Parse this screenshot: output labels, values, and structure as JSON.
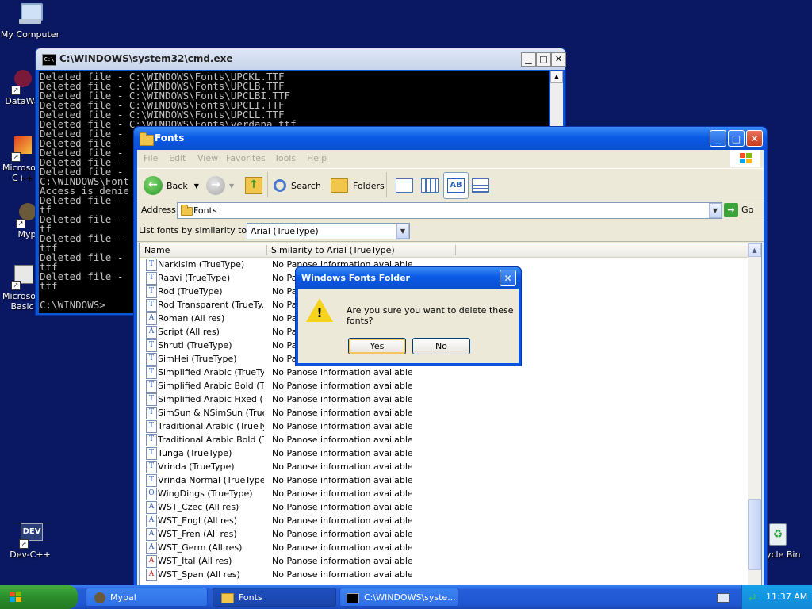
{
  "desktop": {
    "icons": [
      {
        "label": "My Computer"
      },
      {
        "label": "DataWa"
      },
      {
        "label": "Microsoft C++"
      },
      {
        "label": "Myp"
      },
      {
        "label": "Microsoft Basic"
      },
      {
        "label": "Dev-C++"
      },
      {
        "label": "ycle Bin"
      }
    ]
  },
  "cmd": {
    "title": "C:\\WINDOWS\\system32\\cmd.exe",
    "lines": [
      "Deleted file - C:\\WINDOWS\\Fonts\\UPCKL.TTF",
      "Deleted file - C:\\WINDOWS\\Fonts\\UPCLB.TTF",
      "Deleted file - C:\\WINDOWS\\Fonts\\UPCLBI.TTF",
      "Deleted file - C:\\WINDOWS\\Fonts\\UPCLI.TTF",
      "Deleted file - C:\\WINDOWS\\Fonts\\UPCLL.TTF",
      "Deleted file - C:\\WINDOWS\\Fonts\\verdana.ttf",
      "Deleted file -",
      "Deleted file -",
      "Deleted file -",
      "Deleted file -",
      "Deleted file -",
      "C:\\WINDOWS\\Font",
      "Access is denie",
      "Deleted file -",
      "tf",
      "Deleted file -",
      "tf",
      "Deleted file -",
      "ttf",
      "Deleted file -",
      "ttf",
      "Deleted file -",
      "ttf",
      "",
      "C:\\WINDOWS>"
    ]
  },
  "fonts_window": {
    "title": "Fonts",
    "menu": [
      "File",
      "Edit",
      "View",
      "Favorites",
      "Tools",
      "Help"
    ],
    "toolbar": {
      "back": "Back",
      "search": "Search",
      "folders": "Folders"
    },
    "address_label": "Address",
    "address_value": "Fonts",
    "go_label": "Go",
    "similarity_label": "List fonts by similarity to:",
    "similarity_value": "Arial (TrueType)",
    "columns": {
      "name": "Name",
      "similarity": "Similarity to Arial (TrueType)"
    },
    "rows": [
      {
        "name": "Narkisim (TrueType)",
        "sim": "No Panose information available",
        "icon": "T"
      },
      {
        "name": "Raavi (TrueType)",
        "sim": "No Par",
        "icon": "T"
      },
      {
        "name": "Rod (TrueType)",
        "sim": "No Par",
        "icon": "T"
      },
      {
        "name": "Rod Transparent (TrueTy...",
        "sim": "No Par",
        "icon": "T"
      },
      {
        "name": "Roman (All res)",
        "sim": "No Par",
        "icon": "A"
      },
      {
        "name": "Script (All res)",
        "sim": "No Par",
        "icon": "A"
      },
      {
        "name": "Shruti (TrueType)",
        "sim": "No Par",
        "icon": "T"
      },
      {
        "name": "SimHei (TrueType)",
        "sim": "No Par",
        "icon": "T"
      },
      {
        "name": "Simplified Arabic (TrueType)",
        "sim": "No Panose information available",
        "icon": "T"
      },
      {
        "name": "Simplified Arabic Bold (Tru...",
        "sim": "No Panose information available",
        "icon": "T"
      },
      {
        "name": "Simplified Arabic Fixed (Tr...",
        "sim": "No Panose information available",
        "icon": "T"
      },
      {
        "name": "SimSun & NSimSun (TrueT...",
        "sim": "No Panose information available",
        "icon": "T"
      },
      {
        "name": "Traditional Arabic (TrueTy...",
        "sim": "No Panose information available",
        "icon": "T"
      },
      {
        "name": "Traditional Arabic Bold (Tr...",
        "sim": "No Panose information available",
        "icon": "T"
      },
      {
        "name": "Tunga (TrueType)",
        "sim": "No Panose information available",
        "icon": "T"
      },
      {
        "name": "Vrinda (TrueType)",
        "sim": "No Panose information available",
        "icon": "T"
      },
      {
        "name": "Vrinda Normal (TrueType)",
        "sim": "No Panose information available",
        "icon": "T"
      },
      {
        "name": "WingDings (TrueType)",
        "sim": "No Panose information available",
        "icon": "O"
      },
      {
        "name": "WST_Czec (All res)",
        "sim": "No Panose information available",
        "icon": "A"
      },
      {
        "name": "WST_Engl (All res)",
        "sim": "No Panose information available",
        "icon": "A"
      },
      {
        "name": "WST_Fren (All res)",
        "sim": "No Panose information available",
        "icon": "A"
      },
      {
        "name": "WST_Germ (All res)",
        "sim": "No Panose information available",
        "icon": "A"
      },
      {
        "name": "WST_Ital (All res)",
        "sim": "No Panose information available",
        "icon": "A-red"
      },
      {
        "name": "WST_Span (All res)",
        "sim": "No Panose information available",
        "icon": "A-red"
      }
    ]
  },
  "dialog": {
    "title": "Windows Fonts Folder",
    "message": "Are you sure you want to delete these fonts?",
    "yes": "Yes",
    "no": "No"
  },
  "taskbar": {
    "start_icon": "windows-flag-icon",
    "tasks": [
      {
        "label": "Mypal"
      },
      {
        "label": "Fonts"
      },
      {
        "label": "C:\\WINDOWS\\syste..."
      }
    ],
    "clock": "11:37 AM"
  },
  "colors": {
    "desktop": "#0a1763",
    "titlebar": "#0a54e0",
    "window_body": "#ece9d8",
    "start": "#2c8d2c"
  }
}
